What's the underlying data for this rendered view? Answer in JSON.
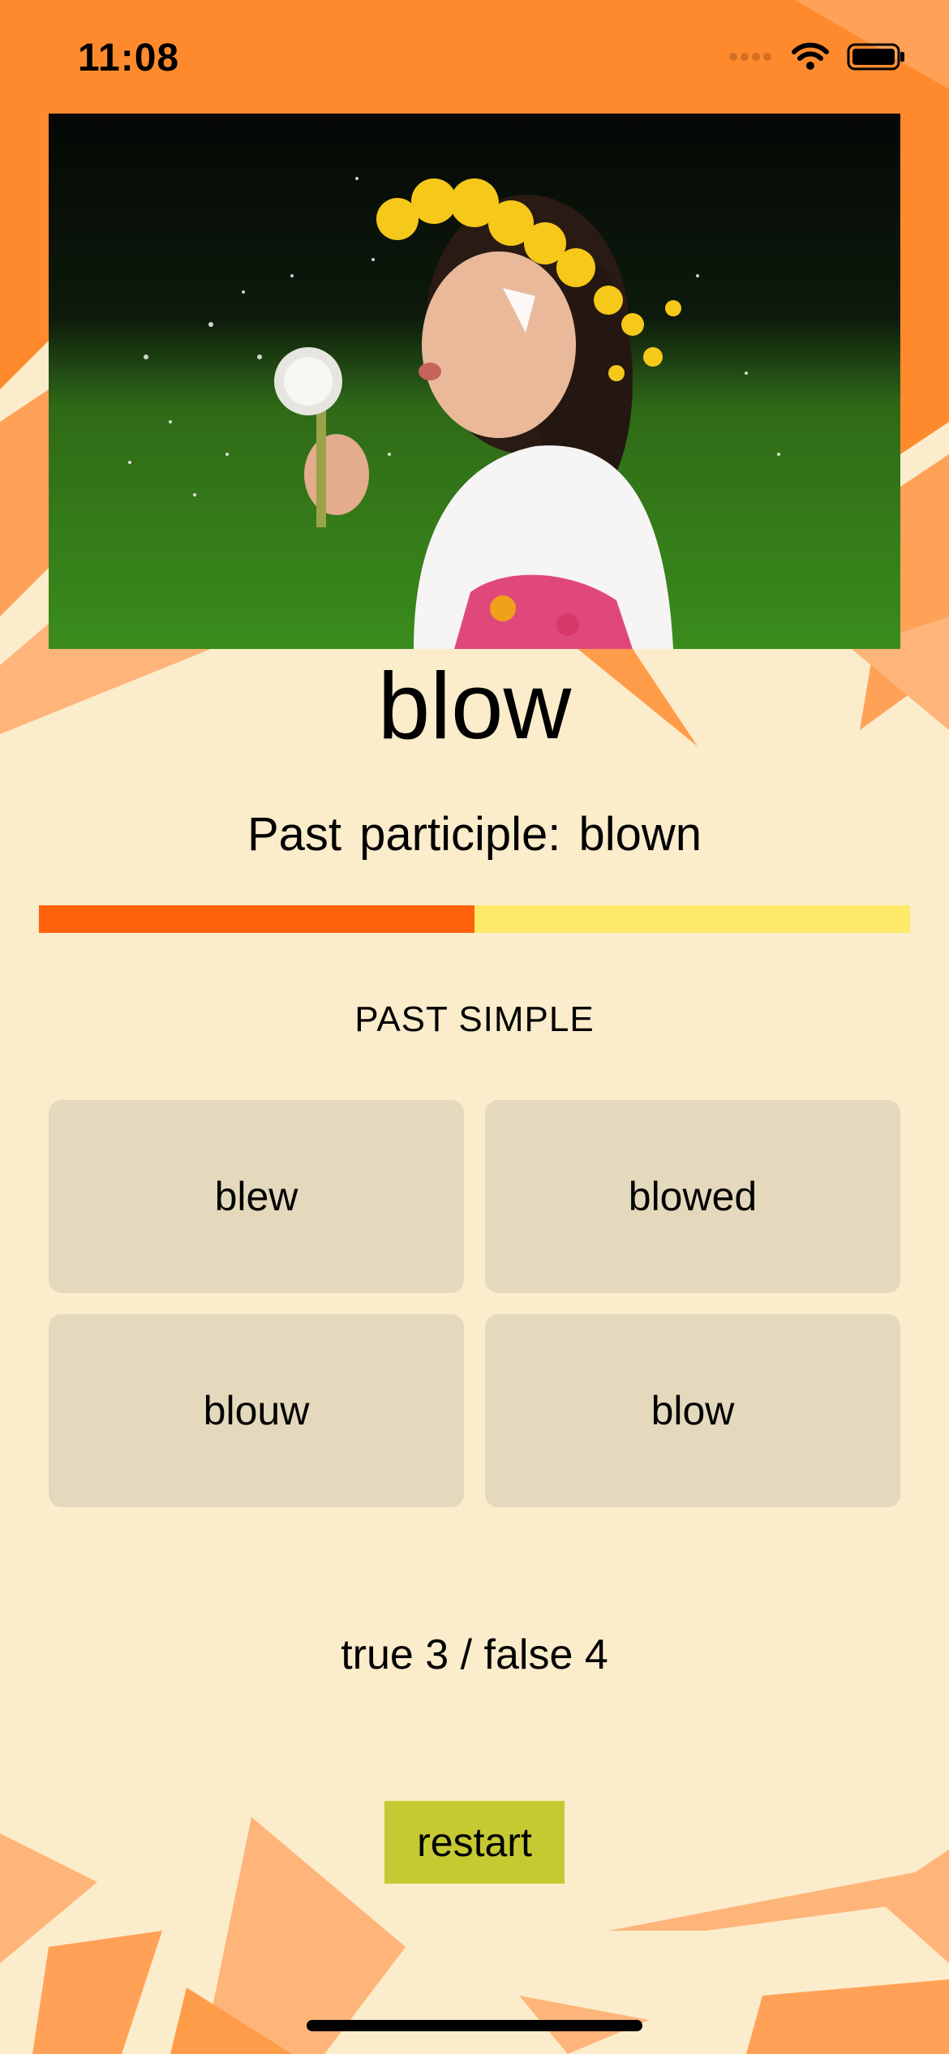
{
  "status_bar": {
    "time": "11:08",
    "icons": [
      "signal-dots-icon",
      "wifi-icon",
      "battery-icon"
    ]
  },
  "card": {
    "image_subject": "girl-blowing-dandelion",
    "verb": "blow",
    "participle_text": "Past participle: blown",
    "progress": 0.5,
    "section_title": "PAST SIMPLE",
    "answers": [
      "blew",
      "blowed",
      "blouw",
      "blow"
    ],
    "score_text": "true 3 / false 4",
    "restart_label": "restart"
  },
  "colors": {
    "background": "#fbeccb",
    "top_orange": "#ff8a2e",
    "shard": "#ffae6e",
    "progress_fill": "#ff620b",
    "progress_track": "#ffe96a",
    "answer_bg": "#e4d9bc",
    "restart_bg": "#c6c932"
  }
}
